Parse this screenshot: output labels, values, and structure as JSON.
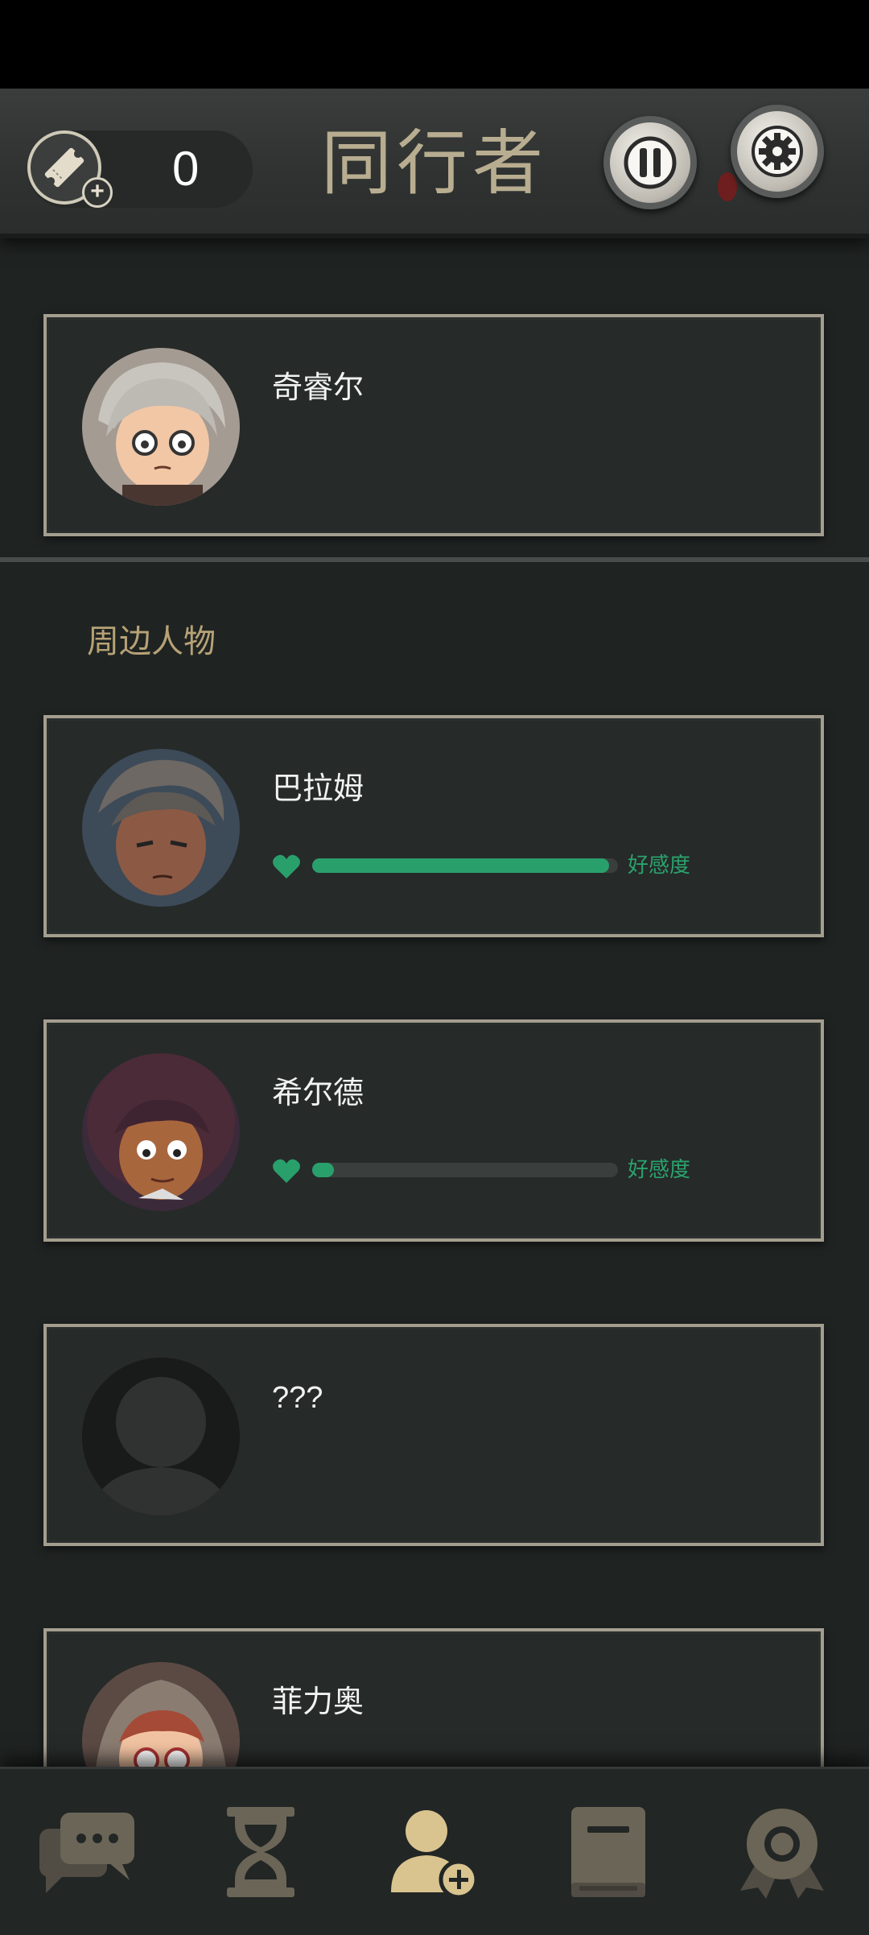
{
  "header": {
    "title": "同行者",
    "ticket_count": "0",
    "ticket_icon": "ticket-icon",
    "pause_icon": "pause-icon",
    "settings_icon": "gear-icon"
  },
  "player": {
    "name": "奇睿尔"
  },
  "section": {
    "title": "周边人物"
  },
  "characters": [
    {
      "name": "巴拉姆",
      "affinity_label": "好感度",
      "affinity": 0.97
    },
    {
      "name": "希尔德",
      "affinity_label": "好感度",
      "affinity": 0.07
    },
    {
      "name": "???"
    },
    {
      "name": "菲力奥"
    }
  ],
  "colors": {
    "accent_gold": "#b8ad90",
    "affinity_green": "#29a06c",
    "card_border": "#a49e8f",
    "active_nav": "#d9c48f"
  },
  "bottom_nav": [
    {
      "icon": "chat-icon",
      "active": false
    },
    {
      "icon": "hourglass-icon",
      "active": false
    },
    {
      "icon": "companion-add-icon",
      "active": true
    },
    {
      "icon": "book-icon",
      "active": false
    },
    {
      "icon": "badge-icon",
      "active": false
    }
  ]
}
